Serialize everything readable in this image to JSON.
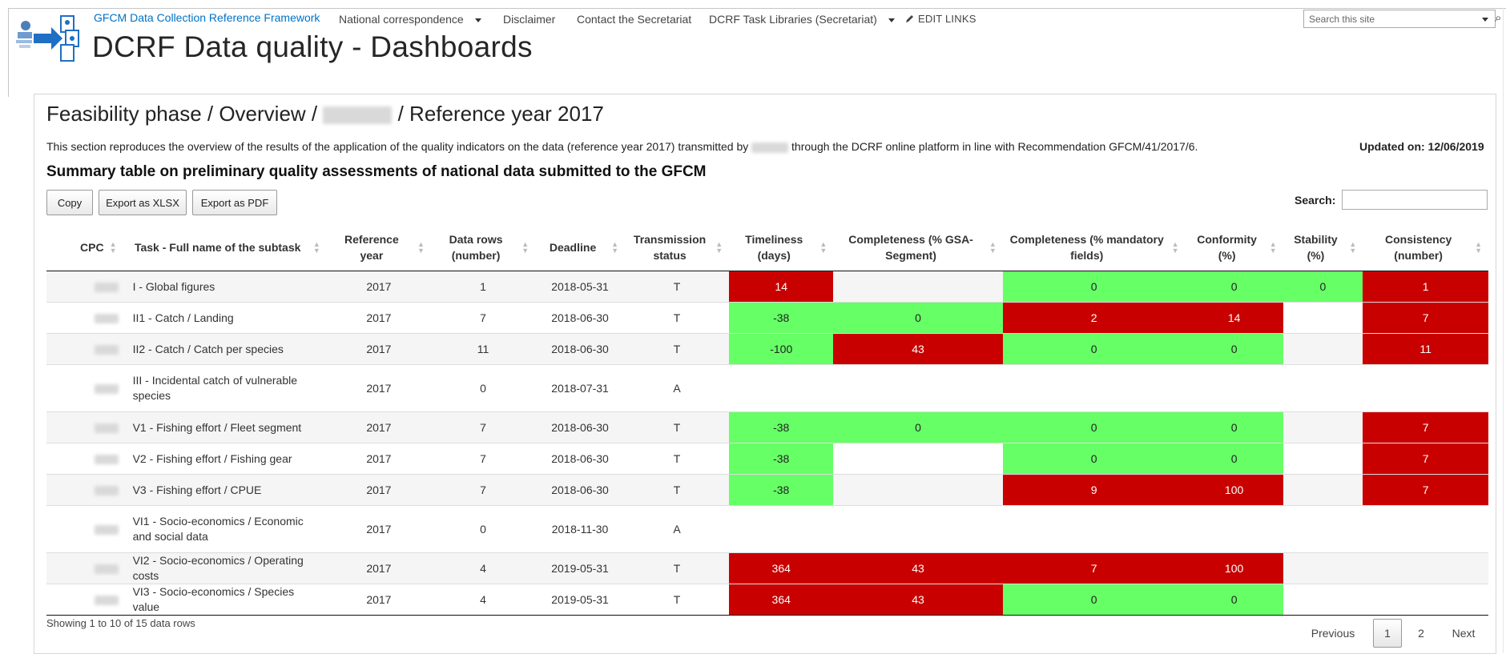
{
  "header": {
    "site_title": "GFCM Data Collection Reference Framework",
    "page_title": "DCRF Data quality - Dashboards",
    "nav": [
      {
        "label": "National correspondence",
        "has_dropdown": true
      },
      {
        "label": "Disclaimer",
        "has_dropdown": false
      },
      {
        "label": "Contact the Secretariat",
        "has_dropdown": false
      },
      {
        "label": "DCRF Task Libraries (Secretariat)",
        "has_dropdown": true
      }
    ],
    "edit_links": "EDIT LINKS",
    "search_placeholder": "Search this site"
  },
  "content": {
    "breadcrumb_prefix": "Feasibility phase / Overview /",
    "breadcrumb_suffix": "/ Reference year 2017",
    "description_before": "This section reproduces the overview of the results of the application of the quality indicators on the data (reference year 2017) transmitted by",
    "description_after": "through the DCRF online platform in line with Recommendation GFCM/41/2017/6.",
    "updated": "Updated on: 12/06/2019",
    "summary_title": "Summary table on preliminary quality assessments of national data submitted to the GFCM",
    "buttons": {
      "copy": "Copy",
      "xlsx": "Export as XLSX",
      "pdf": "Export as PDF"
    },
    "search_label": "Search:"
  },
  "table": {
    "columns": [
      "CPC",
      "Task - Full name of the subtask",
      "Reference year",
      "Data rows (number)",
      "Deadline",
      "Transmission status",
      "Timeliness (days)",
      "Completeness (% GSA-Segment)",
      "Completeness (% mandatory fields)",
      "Conformity (%)",
      "Stability (%)",
      "Consistency (number)"
    ],
    "rows": [
      {
        "task": "I - Global figures",
        "year": "2017",
        "rows": "1",
        "deadline": "2018-05-31",
        "status": "T",
        "timeliness": "14",
        "tl_color": "red",
        "comp_gsa": "",
        "gsa_color": "",
        "comp_mand": "0",
        "mand_color": "green",
        "conformity": "0",
        "conf_color": "green",
        "stability": "0",
        "stab_color": "green",
        "consistency": "1",
        "cons_color": "red"
      },
      {
        "task": "II1 - Catch / Landing",
        "year": "2017",
        "rows": "7",
        "deadline": "2018-06-30",
        "status": "T",
        "timeliness": "-38",
        "tl_color": "green",
        "comp_gsa": "0",
        "gsa_color": "green",
        "comp_mand": "2",
        "mand_color": "red",
        "conformity": "14",
        "conf_color": "red",
        "stability": "",
        "stab_color": "",
        "consistency": "7",
        "cons_color": "red"
      },
      {
        "task": "II2 - Catch / Catch per species",
        "year": "2017",
        "rows": "11",
        "deadline": "2018-06-30",
        "status": "T",
        "timeliness": "-100",
        "tl_color": "green",
        "comp_gsa": "43",
        "gsa_color": "red",
        "comp_mand": "0",
        "mand_color": "green",
        "conformity": "0",
        "conf_color": "green",
        "stability": "",
        "stab_color": "",
        "consistency": "11",
        "cons_color": "red"
      },
      {
        "task": "III - Incidental catch of vulnerable species",
        "year": "2017",
        "rows": "0",
        "deadline": "2018-07-31",
        "status": "A",
        "timeliness": "",
        "tl_color": "",
        "comp_gsa": "",
        "gsa_color": "",
        "comp_mand": "",
        "mand_color": "",
        "conformity": "",
        "conf_color": "",
        "stability": "",
        "stab_color": "",
        "consistency": "",
        "cons_color": "",
        "tall": true
      },
      {
        "task": "V1 - Fishing effort / Fleet segment",
        "year": "2017",
        "rows": "7",
        "deadline": "2018-06-30",
        "status": "T",
        "timeliness": "-38",
        "tl_color": "green",
        "comp_gsa": "0",
        "gsa_color": "green",
        "comp_mand": "0",
        "mand_color": "green",
        "conformity": "0",
        "conf_color": "green",
        "stability": "",
        "stab_color": "",
        "consistency": "7",
        "cons_color": "red"
      },
      {
        "task": "V2 - Fishing effort / Fishing gear",
        "year": "2017",
        "rows": "7",
        "deadline": "2018-06-30",
        "status": "T",
        "timeliness": "-38",
        "tl_color": "green",
        "comp_gsa": "",
        "gsa_color": "",
        "comp_mand": "0",
        "mand_color": "green",
        "conformity": "0",
        "conf_color": "green",
        "stability": "",
        "stab_color": "",
        "consistency": "7",
        "cons_color": "red"
      },
      {
        "task": "V3 - Fishing effort / CPUE",
        "year": "2017",
        "rows": "7",
        "deadline": "2018-06-30",
        "status": "T",
        "timeliness": "-38",
        "tl_color": "green",
        "comp_gsa": "",
        "gsa_color": "",
        "comp_mand": "9",
        "mand_color": "red",
        "conformity": "100",
        "conf_color": "red",
        "stability": "",
        "stab_color": "",
        "consistency": "7",
        "cons_color": "red"
      },
      {
        "task": "VI1 - Socio-economics / Economic and social data",
        "year": "2017",
        "rows": "0",
        "deadline": "2018-11-30",
        "status": "A",
        "timeliness": "",
        "tl_color": "",
        "comp_gsa": "",
        "gsa_color": "",
        "comp_mand": "",
        "mand_color": "",
        "conformity": "",
        "conf_color": "",
        "stability": "",
        "stab_color": "",
        "consistency": "",
        "cons_color": "",
        "tall": true
      },
      {
        "task": "VI2 - Socio-economics / Operating costs",
        "year": "2017",
        "rows": "4",
        "deadline": "2019-05-31",
        "status": "T",
        "timeliness": "364",
        "tl_color": "red",
        "comp_gsa": "43",
        "gsa_color": "red",
        "comp_mand": "7",
        "mand_color": "red",
        "conformity": "100",
        "conf_color": "red",
        "stability": "",
        "stab_color": "",
        "consistency": "",
        "cons_color": ""
      },
      {
        "task": "VI3 - Socio-economics / Species value",
        "year": "2017",
        "rows": "4",
        "deadline": "2019-05-31",
        "status": "T",
        "timeliness": "364",
        "tl_color": "red",
        "comp_gsa": "43",
        "gsa_color": "red",
        "comp_mand": "0",
        "mand_color": "green",
        "conformity": "0",
        "conf_color": "green",
        "stability": "",
        "stab_color": "",
        "consistency": "",
        "cons_color": ""
      }
    ]
  },
  "footer": {
    "showing": "Showing 1 to 10 of 15 data rows",
    "previous": "Previous",
    "pages": [
      "1",
      "2"
    ],
    "next": "Next"
  },
  "colors": {
    "accent": "#0072c6",
    "bad": "#c90000",
    "good": "#66ff66"
  }
}
